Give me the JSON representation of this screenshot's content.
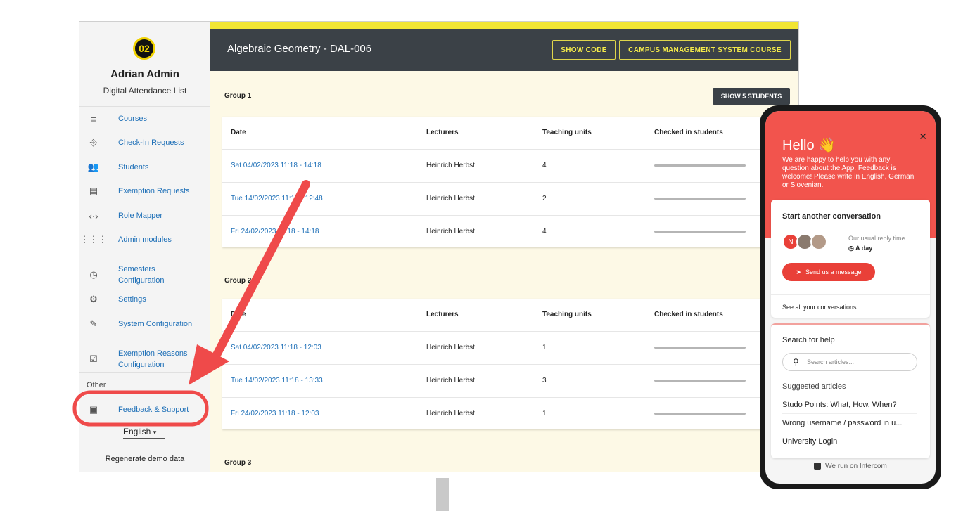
{
  "sidebar": {
    "logo_text": "02",
    "user_name": "Adrian Admin",
    "app_subtitle": "Digital Attendance List",
    "items": [
      {
        "label": "Courses",
        "icon": "list-icon"
      },
      {
        "label": "Check-In Requests",
        "icon": "checkin-icon"
      },
      {
        "label": "Students",
        "icon": "people-icon"
      },
      {
        "label": "Exemption Requests",
        "icon": "calendar-icon"
      },
      {
        "label": "Role Mapper",
        "icon": "code-icon"
      },
      {
        "label": "Admin modules",
        "icon": "grid-icon"
      },
      {
        "label": "Semesters Configuration",
        "icon": "clock-icon"
      },
      {
        "label": "Settings",
        "icon": "gear-icon"
      },
      {
        "label": "System Configuration",
        "icon": "pencil-icon"
      },
      {
        "label": "Exemption Reasons Configuration",
        "icon": "event-check-icon"
      }
    ],
    "other_label": "Other",
    "feedback_label": "Feedback & Support",
    "language": "English",
    "regenerate_label": "Regenerate demo data"
  },
  "header": {
    "course_title": "Algebraic Geometry",
    "course_code": "DAL-006",
    "show_code": "SHOW CODE",
    "cms_course": "CAMPUS MANAGEMENT SYSTEM COURSE"
  },
  "groups": [
    {
      "title": "Group 1",
      "show_students": "SHOW 5 STUDENTS",
      "columns": [
        "Date",
        "Lecturers",
        "Teaching units",
        "Checked in students"
      ],
      "rows": [
        {
          "date": "Sat 04/02/2023 11:18 - 14:18",
          "lecturer": "Heinrich Herbst",
          "units": "4"
        },
        {
          "date": "Tue 14/02/2023 11:18 - 12:48",
          "lecturer": "Heinrich Herbst",
          "units": "2"
        },
        {
          "date": "Fri 24/02/2023 11:18 - 14:18",
          "lecturer": "Heinrich Herbst",
          "units": "4"
        }
      ]
    },
    {
      "title": "Group 2",
      "columns": [
        "Date",
        "Lecturers",
        "Teaching units",
        "Checked in students"
      ],
      "rows": [
        {
          "date": "Sat 04/02/2023 11:18 - 12:03",
          "lecturer": "Heinrich Herbst",
          "units": "1"
        },
        {
          "date": "Tue 14/02/2023 11:18 - 13:33",
          "lecturer": "Heinrich Herbst",
          "units": "3"
        },
        {
          "date": "Fri 24/02/2023 11:18 - 12:03",
          "lecturer": "Heinrich Herbst",
          "units": "1"
        }
      ]
    },
    {
      "title": "Group 3"
    }
  ],
  "chat": {
    "greeting": "Hello 👋",
    "intro": "We are happy to help you with any question about the App. Feedback is welcome! Please write in English, German or Slovenian.",
    "start_conversation": "Start another conversation",
    "avatar_initial": "N",
    "reply_label": "Our usual reply time",
    "reply_value": "A day",
    "send_button": "Send us a message",
    "see_all": "See all your conversations",
    "search_title": "Search for help",
    "search_placeholder": "Search articles...",
    "suggested_title": "Suggested articles",
    "articles": [
      "Studo Points: What, How, When?",
      "Wrong username / password in u...",
      "University Login"
    ],
    "footer": "We run on Intercom"
  },
  "colors": {
    "accent_yellow": "#f1e534",
    "header_dark": "#3b4147",
    "link_blue": "#1d6fb7",
    "chat_red": "#f2544d",
    "highlight_red": "#ef4a4a"
  }
}
